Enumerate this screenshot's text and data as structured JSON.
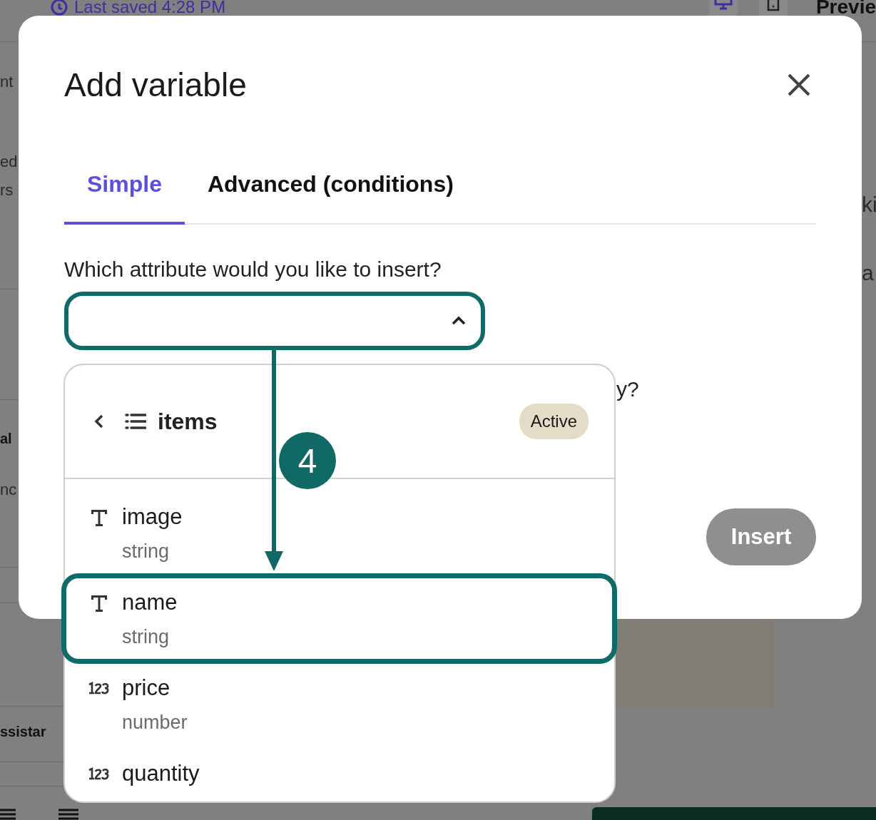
{
  "background": {
    "last_saved": "Last saved 4:28 PM",
    "preview": "Previe",
    "left_fragments": [
      {
        "text": "nt",
        "kind": "plain"
      },
      {
        "text": "ed",
        "kind": "plain"
      },
      {
        "text": "rs",
        "kind": "plain"
      },
      {
        "text": "al",
        "kind": "bold"
      },
      {
        "text": "nc",
        "kind": "plain"
      },
      {
        "text": "ssistar",
        "kind": "bold"
      }
    ],
    "right_fragments": [
      {
        "text": "ki"
      },
      {
        "text": "a"
      }
    ]
  },
  "dialog": {
    "title": "Add variable",
    "tabs": [
      {
        "label": "Simple",
        "selected": true
      },
      {
        "label": "Advanced (conditions)",
        "selected": false
      }
    ],
    "question": "Which attribute would you like to insert?",
    "second_question_end": "y?",
    "select": {
      "expanded": true
    },
    "insert_button": {
      "label": "Insert",
      "disabled": true
    }
  },
  "dropdown": {
    "header": {
      "title": "items",
      "badge": "Active"
    },
    "items": [
      {
        "name": "image",
        "type": "string",
        "kind": "text",
        "highlighted": false
      },
      {
        "name": "name",
        "type": "string",
        "kind": "text",
        "highlighted": true
      },
      {
        "name": "price",
        "type": "number",
        "kind": "number",
        "highlighted": false
      },
      {
        "name": "quantity",
        "kind": "number",
        "highlighted": false
      }
    ]
  },
  "annotation": {
    "step": "4"
  }
}
